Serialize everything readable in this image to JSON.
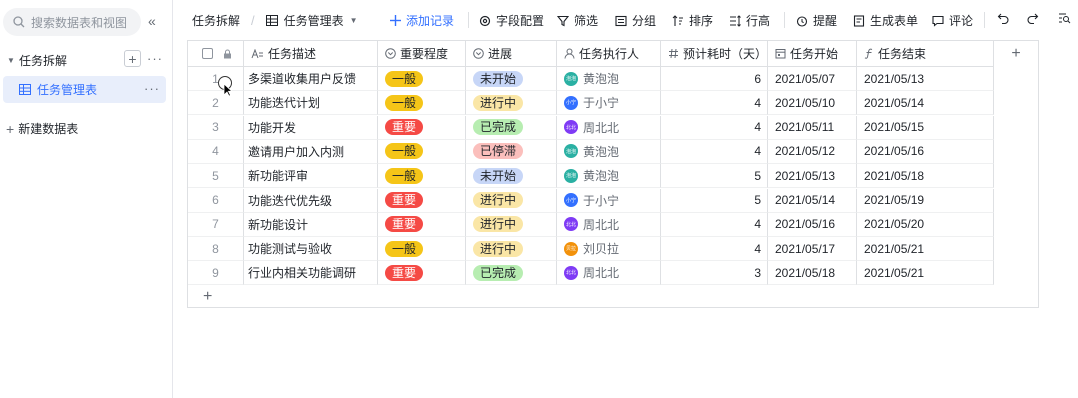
{
  "sidebar": {
    "search_placeholder": "搜索数据表和视图",
    "collapse_glyph": "«",
    "base_name": "任务拆解",
    "table_name": "任务管理表",
    "new_table_label": "新建数据表"
  },
  "toolbar": {
    "breadcrumb": "任务拆解",
    "view_name": "任务管理表",
    "add_record": "添加记录",
    "field_config": "字段配置",
    "filter": "筛选",
    "group": "分组",
    "sort": "排序",
    "row_height": "行高",
    "reminder": "提醒",
    "gen_form": "生成表单",
    "comment": "评论"
  },
  "columns": [
    "任务描述",
    "重要程度",
    "进展",
    "任务执行人",
    "预计耗时（天）",
    "任务开始",
    "任务结束"
  ],
  "colors": {
    "accent": "#3370ff",
    "tag_normal": "#f5c518",
    "tag_important": "#f54a45",
    "status_not_started": "#c7d6f7",
    "status_in_progress": "#fae6a6",
    "status_done": "#b7edb1",
    "status_paused": "#fbbfbc"
  },
  "rows": [
    {
      "num": "1",
      "desc": "多渠道收集用户反馈",
      "level": "一般",
      "status": "未开始",
      "owner": "黄泡泡",
      "owner_short": "泡泡",
      "days": "6",
      "start": "2021/05/07",
      "end": "2021/05/13"
    },
    {
      "num": "2",
      "desc": "功能迭代计划",
      "level": "一般",
      "status": "进行中",
      "owner": "于小宁",
      "owner_short": "小宁",
      "days": "4",
      "start": "2021/05/10",
      "end": "2021/05/14"
    },
    {
      "num": "3",
      "desc": "功能开发",
      "level": "重要",
      "status": "已完成",
      "owner": "周北北",
      "owner_short": "北北",
      "days": "4",
      "start": "2021/05/11",
      "end": "2021/05/15"
    },
    {
      "num": "4",
      "desc": "邀请用户加入内测",
      "level": "一般",
      "status": "已停滞",
      "owner": "黄泡泡",
      "owner_short": "泡泡",
      "days": "4",
      "start": "2021/05/12",
      "end": "2021/05/16"
    },
    {
      "num": "5",
      "desc": "新功能评审",
      "level": "一般",
      "status": "未开始",
      "owner": "黄泡泡",
      "owner_short": "泡泡",
      "days": "5",
      "start": "2021/05/13",
      "end": "2021/05/18"
    },
    {
      "num": "6",
      "desc": "功能迭代优先级",
      "level": "重要",
      "status": "进行中",
      "owner": "于小宁",
      "owner_short": "小宁",
      "days": "5",
      "start": "2021/05/14",
      "end": "2021/05/19"
    },
    {
      "num": "7",
      "desc": "新功能设计",
      "level": "重要",
      "status": "进行中",
      "owner": "周北北",
      "owner_short": "北北",
      "days": "4",
      "start": "2021/05/16",
      "end": "2021/05/20"
    },
    {
      "num": "8",
      "desc": "功能测试与验收",
      "level": "一般",
      "status": "进行中",
      "owner": "刘贝拉",
      "owner_short": "贝拉",
      "days": "4",
      "start": "2021/05/17",
      "end": "2021/05/21"
    },
    {
      "num": "9",
      "desc": "行业内相关功能调研",
      "level": "重要",
      "status": "已完成",
      "owner": "周北北",
      "owner_short": "北北",
      "days": "3",
      "start": "2021/05/18",
      "end": "2021/05/21"
    }
  ]
}
